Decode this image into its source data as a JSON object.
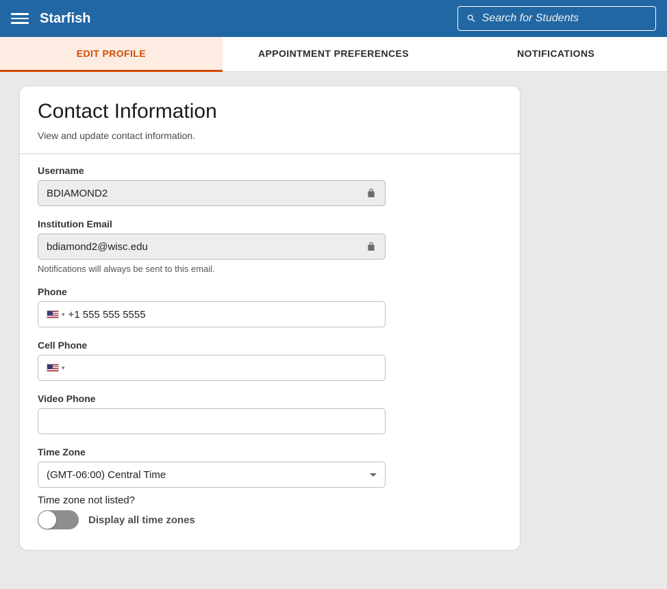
{
  "header": {
    "brand": "Starfish",
    "search_placeholder": "Search for Students"
  },
  "tabs": [
    {
      "label": "EDIT PROFILE",
      "active": true
    },
    {
      "label": "APPOINTMENT PREFERENCES",
      "active": false
    },
    {
      "label": "NOTIFICATIONS",
      "active": false
    }
  ],
  "card": {
    "title": "Contact Information",
    "subtitle": "View and update contact information."
  },
  "fields": {
    "username": {
      "label": "Username",
      "value": "BDIAMOND2"
    },
    "institution_email": {
      "label": "Institution Email",
      "value": "bdiamond2@wisc.edu",
      "hint": "Notifications will always be sent to this email."
    },
    "phone": {
      "label": "Phone",
      "value": "+1 555 555 5555"
    },
    "cell_phone": {
      "label": "Cell Phone",
      "value": ""
    },
    "video_phone": {
      "label": "Video Phone",
      "value": ""
    },
    "time_zone": {
      "label": "Time Zone",
      "value": "(GMT-06:00) Central Time",
      "question": "Time zone not listed?",
      "toggle_label": "Display all time zones",
      "toggle_on": false
    }
  }
}
